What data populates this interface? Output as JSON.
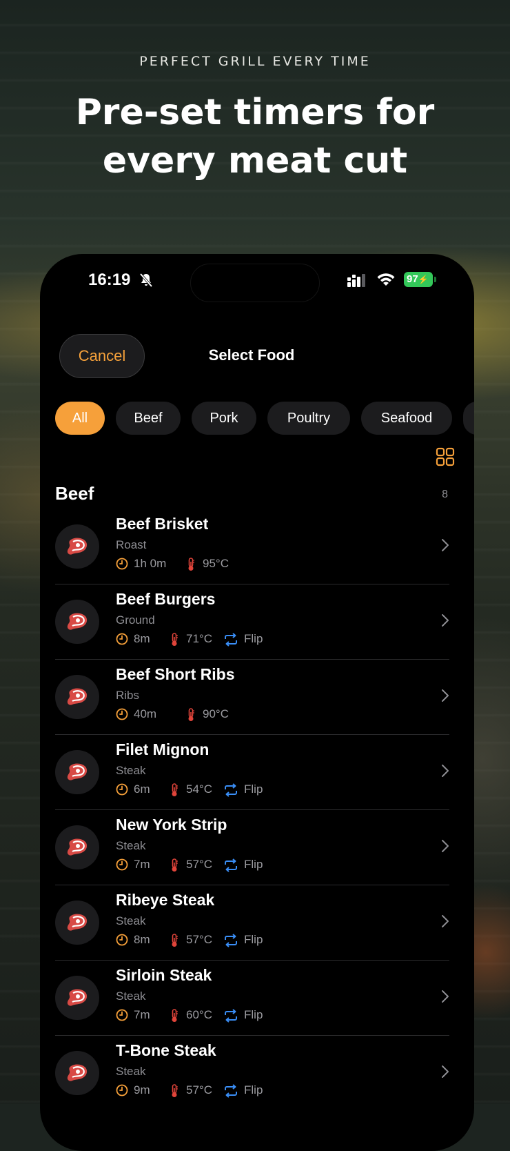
{
  "promo": {
    "eyebrow": "PERFECT GRILL EVERY TIME",
    "headline_line1": "Pre-set timers for",
    "headline_line2": "every meat cut"
  },
  "status_bar": {
    "time": "16:19",
    "battery": "97"
  },
  "nav": {
    "cancel_label": "Cancel",
    "title": "Select Food"
  },
  "filters": [
    "All",
    "Beef",
    "Pork",
    "Poultry",
    "Seafood"
  ],
  "selected_filter": "All",
  "section": {
    "title": "Beef",
    "count": "8"
  },
  "items": [
    {
      "name": "Beef Brisket",
      "category": "Roast",
      "time": "1h 0m",
      "temp": "95°C",
      "flip": ""
    },
    {
      "name": "Beef Burgers",
      "category": "Ground",
      "time": "8m",
      "temp": "71°C",
      "flip": "Flip"
    },
    {
      "name": "Beef Short Ribs",
      "category": "Ribs",
      "time": "40m",
      "temp": "90°C",
      "flip": ""
    },
    {
      "name": "Filet Mignon",
      "category": "Steak",
      "time": "6m",
      "temp": "54°C",
      "flip": "Flip"
    },
    {
      "name": "New York Strip",
      "category": "Steak",
      "time": "7m",
      "temp": "57°C",
      "flip": "Flip"
    },
    {
      "name": "Ribeye Steak",
      "category": "Steak",
      "time": "8m",
      "temp": "57°C",
      "flip": "Flip"
    },
    {
      "name": "Sirloin Steak",
      "category": "Steak",
      "time": "7m",
      "temp": "60°C",
      "flip": "Flip"
    },
    {
      "name": "T-Bone Steak",
      "category": "Steak",
      "time": "9m",
      "temp": "57°C",
      "flip": "Flip"
    }
  ],
  "colors": {
    "accent": "#f6a03a",
    "flip": "#3a8ef6",
    "temp": "#e0443a",
    "battery": "#33c759"
  },
  "icons": {
    "item": "steak-icon",
    "time": "clock-icon",
    "temp": "thermometer-icon",
    "flip": "flip-arrows-icon",
    "row_action": "chevron-right-icon",
    "view_toggle": "grid-view-icon",
    "mute": "bell-slash-icon"
  }
}
